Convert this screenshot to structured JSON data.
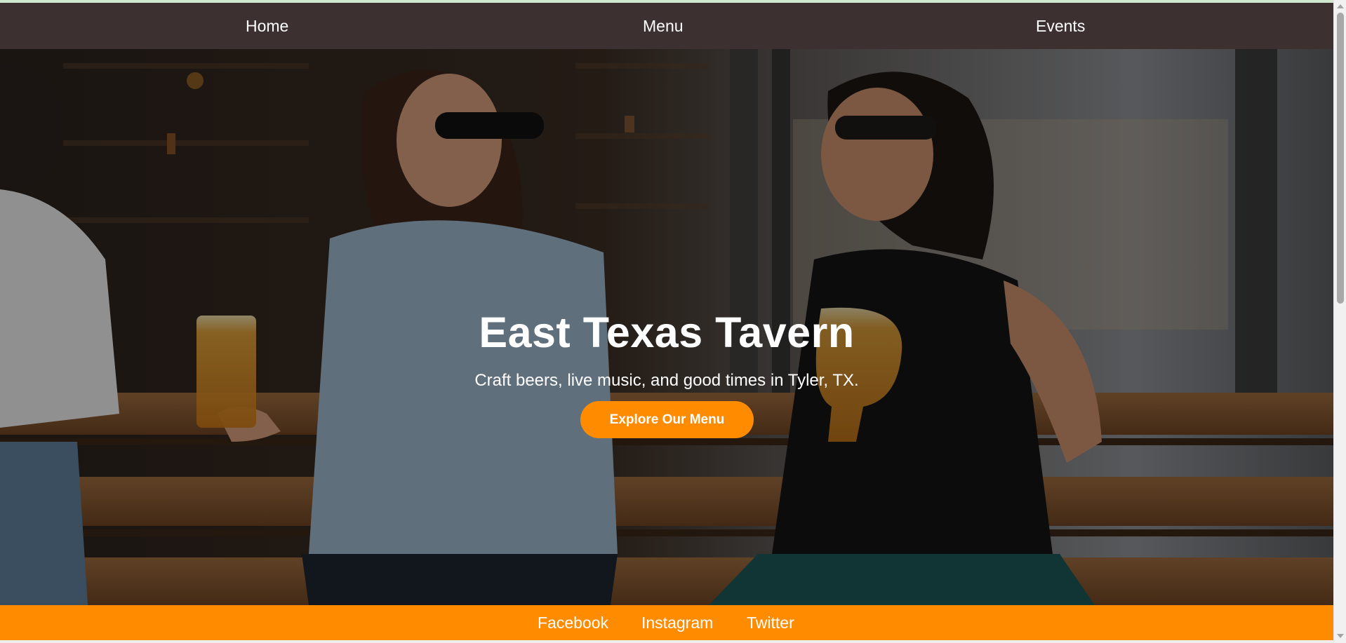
{
  "nav": {
    "items": [
      {
        "label": "Home"
      },
      {
        "label": "Menu"
      },
      {
        "label": "Events"
      }
    ]
  },
  "hero": {
    "title": "East Texas Tavern",
    "tagline": "Craft beers, live music, and good times in Tyler, TX.",
    "cta_label": "Explore Our Menu",
    "image_icon": "photo-two-women-laughing-with-beers-on-bench"
  },
  "footer": {
    "links": [
      {
        "label": "Facebook"
      },
      {
        "label": "Instagram"
      },
      {
        "label": "Twitter"
      }
    ]
  },
  "colors": {
    "nav_bg": "#3d3031",
    "accent": "#ff8b00",
    "text": "#ffffff"
  },
  "scrollbar": {
    "position_fraction": 0.0
  }
}
